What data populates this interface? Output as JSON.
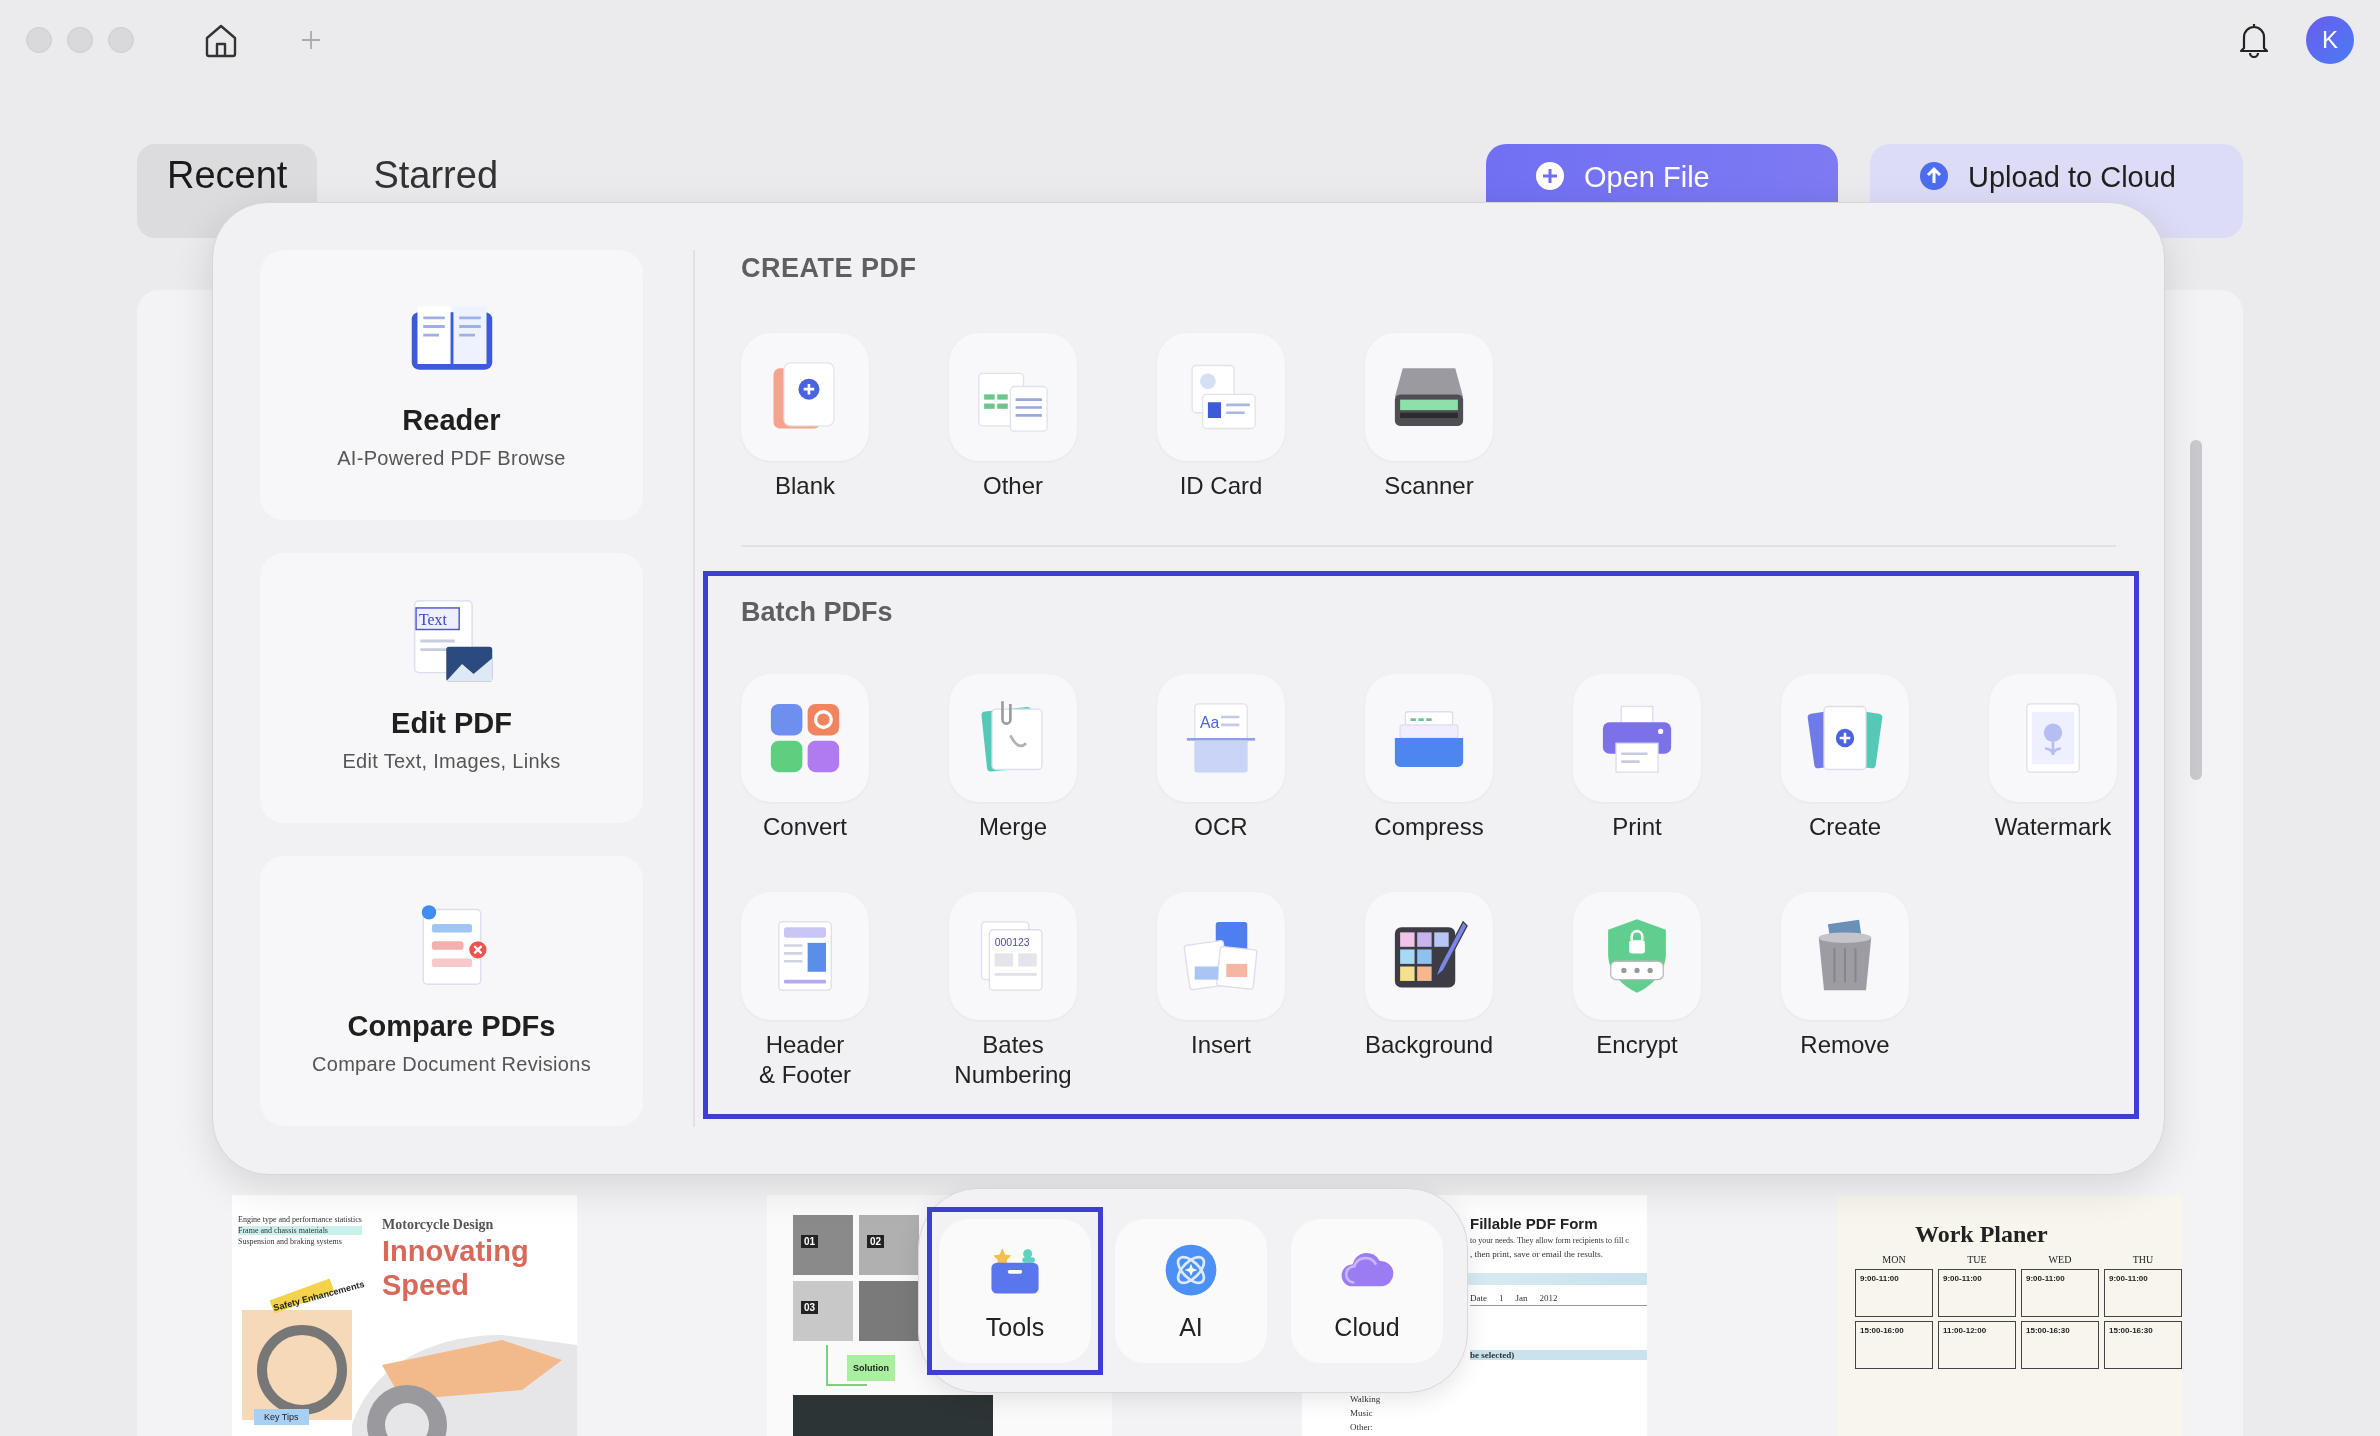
{
  "window": {
    "avatar": "K"
  },
  "tabs": [
    {
      "label": "Recent",
      "selected": true
    },
    {
      "label": "Starred",
      "selected": false
    }
  ],
  "actions": [
    {
      "label": "Open File",
      "kind": "primary"
    },
    {
      "label": "Upload to Cloud",
      "kind": "secondary"
    }
  ],
  "modes": [
    {
      "title": "Reader",
      "subtitle": "AI-Powered PDF Browse"
    },
    {
      "title": "Edit PDF",
      "subtitle": "Edit Text, Images, Links",
      "icon_text": "Text"
    },
    {
      "title": "Compare PDFs",
      "subtitle": "Compare Document Revisions"
    }
  ],
  "create_pdf": {
    "heading": "CREATE PDF",
    "items": [
      {
        "label": "Blank"
      },
      {
        "label": "Other"
      },
      {
        "label": "ID Card"
      },
      {
        "label": "Scanner"
      }
    ]
  },
  "batch_pdfs": {
    "heading": "Batch PDFs",
    "items": [
      {
        "label": "Convert"
      },
      {
        "label": "Merge"
      },
      {
        "label": "OCR",
        "icon_text": "Aa"
      },
      {
        "label": "Compress"
      },
      {
        "label": "Print"
      },
      {
        "label": "Create"
      },
      {
        "label": "Watermark"
      },
      {
        "label": "Header\n& Footer"
      },
      {
        "label": "Bates\nNumbering",
        "icon_text": "000123"
      },
      {
        "label": "Insert"
      },
      {
        "label": "Background"
      },
      {
        "label": "Encrypt"
      },
      {
        "label": "Remove"
      }
    ]
  },
  "dock": [
    {
      "label": "Tools",
      "selected": true
    },
    {
      "label": "AI",
      "selected": false
    },
    {
      "label": "Cloud",
      "selected": false
    }
  ],
  "documents": [
    {
      "kind": "motorcycle",
      "lines": [
        "Engine type and performance statistics",
        "Frame and chassis materials",
        "Suspension and braking systems"
      ],
      "subtitle": "Motorcycle Design",
      "title": [
        "Innovating",
        "Speed"
      ],
      "note": "Safety Enhancements",
      "tag": "Key Tips"
    },
    {
      "kind": "collage",
      "labels": [
        "01",
        "02",
        "03"
      ],
      "box": "Solution"
    },
    {
      "kind": "form",
      "title": "Fillable PDF Form",
      "lines": [
        "to your needs. They allow form recipients to fill c",
        ", then print, save or email the results."
      ],
      "date": [
        "Date",
        "1",
        "Jan",
        "2012"
      ],
      "section": "be selected)",
      "options": [
        "Walking",
        "Music",
        "Other:"
      ]
    },
    {
      "kind": "planner",
      "title": "Work Planer",
      "days": [
        "MON",
        "TUE",
        "WED",
        "THU"
      ],
      "slots": [
        "9:00-11:00",
        "9:00-11:00",
        "9:00-11:00",
        "9:00-11:00",
        "15:00-16:00",
        "11:00-12:00",
        "15:00-16:30",
        "15:00-16:30"
      ]
    }
  ]
}
